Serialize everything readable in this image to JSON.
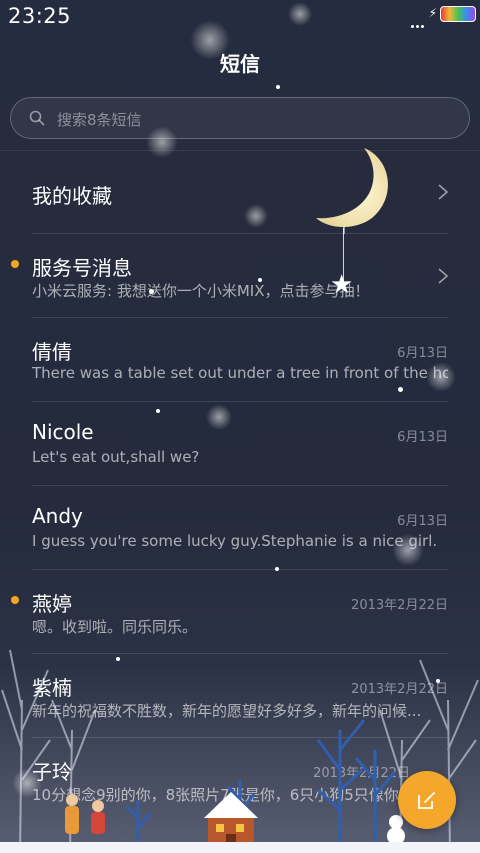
{
  "status_bar": {
    "time": "23:25",
    "charging_icon": "lightning-icon",
    "battery_icon": "battery-icon"
  },
  "header": {
    "title": "短信"
  },
  "search": {
    "placeholder": "搜索8条短信",
    "icon": "search-icon"
  },
  "conversations": [
    {
      "name": "我的收藏",
      "snippet": "",
      "date": "",
      "unread": false,
      "chevron": true
    },
    {
      "name": "服务号消息",
      "snippet": "小米云服务: 我想送你一个小米MIX，点击参与抽！",
      "date": "",
      "unread": true,
      "chevron": true
    },
    {
      "name": "倩倩",
      "snippet": "There was a table set out under a tree in front of the ho...",
      "date": "6月13日",
      "unread": false,
      "chevron": false
    },
    {
      "name": "Nicole",
      "snippet": "Let's eat out,shall we?",
      "date": "6月13日",
      "unread": false,
      "chevron": false
    },
    {
      "name": "Andy",
      "snippet": "I guess you're some lucky guy.Stephanie is a nice girl.",
      "date": "6月13日",
      "unread": false,
      "chevron": false
    },
    {
      "name": "燕婷",
      "snippet": "嗯。收到啦。同乐同乐。",
      "date": "2013年2月22日",
      "unread": true,
      "chevron": false
    },
    {
      "name": "紫楠",
      "snippet": "新年的祝福数不胜数，新年的愿望好多好多，新年的问候...",
      "date": "2013年2月22日",
      "unread": false,
      "chevron": false
    },
    {
      "name": "子玲",
      "snippet": "10分想念9别的你，8张照片7张是你，6只小狗5只像你...",
      "date": "2013年2月22日",
      "unread": false,
      "chevron": false
    }
  ],
  "compose_button": {
    "icon": "compose-icon",
    "color": "#f4a72b"
  },
  "colors": {
    "background": "#242a3d",
    "unread_dot": "#f5a623",
    "accent": "#f4a72b"
  }
}
